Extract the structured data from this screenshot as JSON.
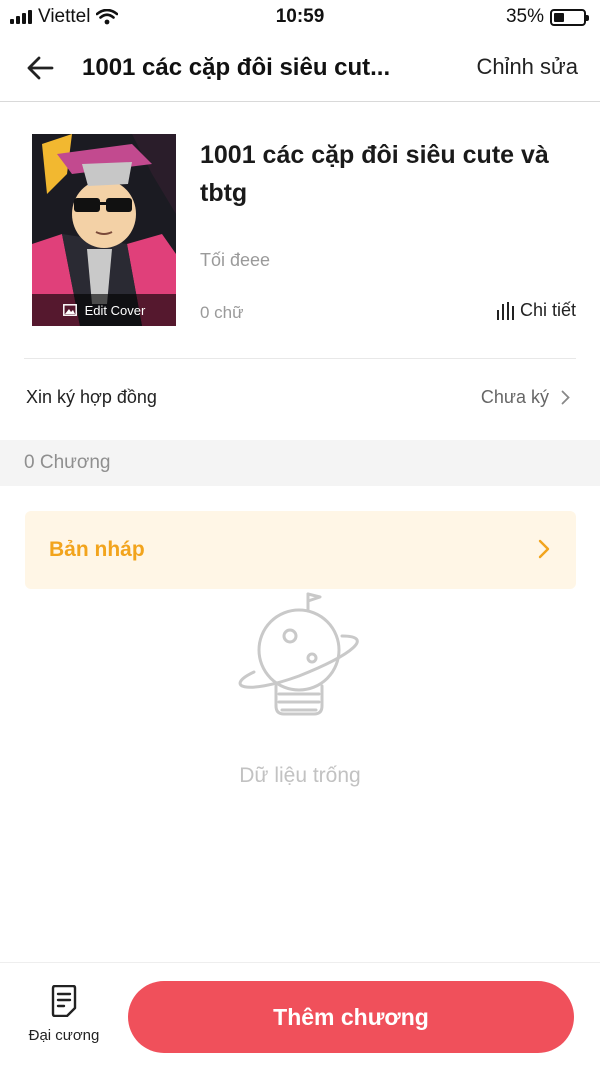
{
  "status_bar": {
    "carrier": "Viettel",
    "time": "10:59",
    "battery": "35%",
    "battery_level": 0.35
  },
  "header": {
    "title": "1001 các cặp đôi siêu cut...",
    "edit_label": "Chỉnh sửa",
    "back_icon": "arrow-left-icon"
  },
  "book": {
    "cover_label": "Edit Cover",
    "title": "1001 các cặp đôi siêu cute và tbtg",
    "description": "Tối đeee",
    "word_count": "0 chữ",
    "detail_label": "Chi tiết"
  },
  "contract": {
    "label": "Xin ký hợp đồng",
    "status": "Chưa ký"
  },
  "chapters": {
    "count_label": "0 Chương"
  },
  "draft": {
    "label": "Bản nháp",
    "accent": "#f2a41d"
  },
  "empty_state": {
    "text": "Dữ liệu trống"
  },
  "bottom_bar": {
    "outline_label": "Đại cương",
    "add_chapter_label": "Thêm chương",
    "button_color": "#f0505b"
  }
}
